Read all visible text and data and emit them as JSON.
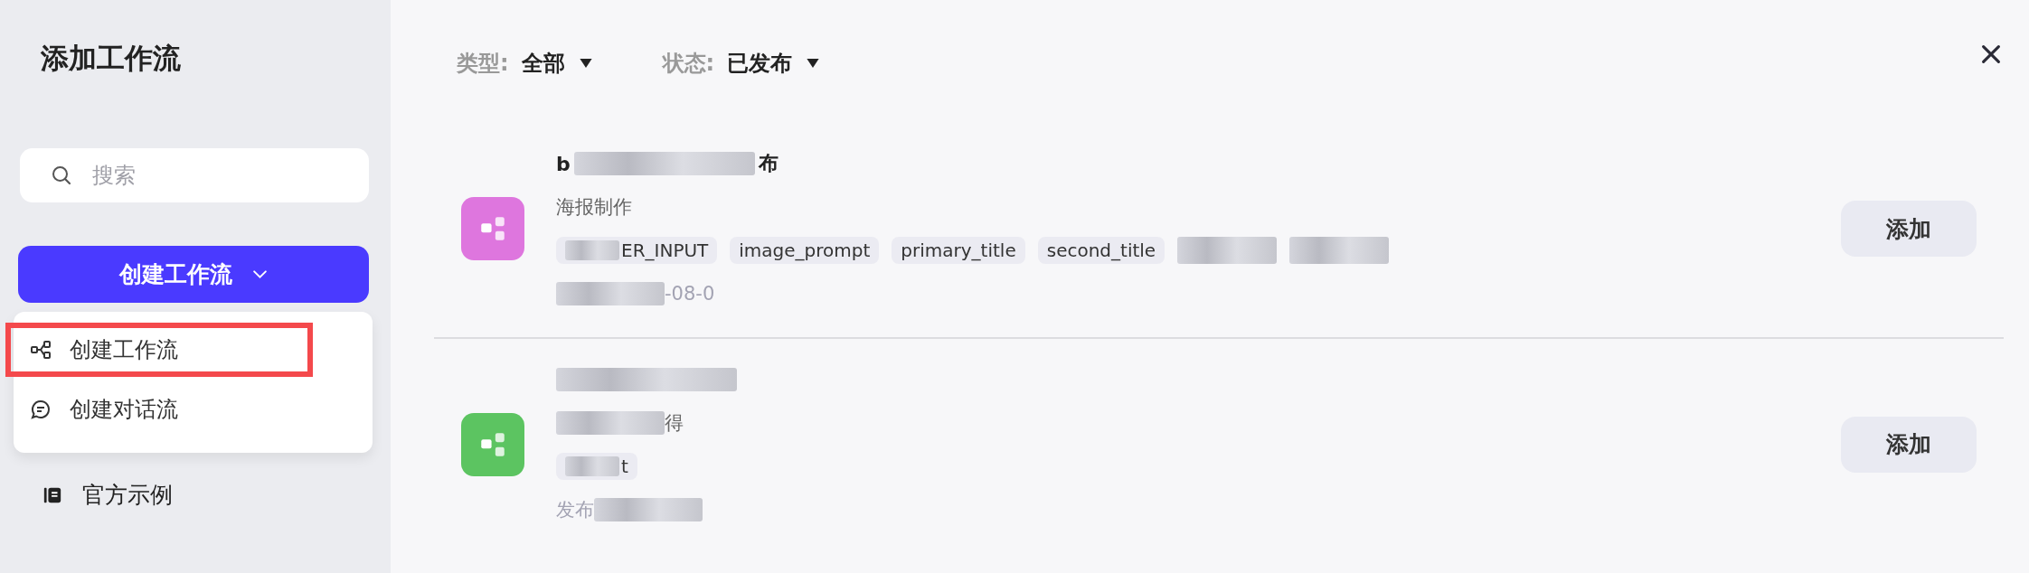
{
  "sidebar": {
    "title": "添加工作流",
    "search": {
      "placeholder": "搜索"
    },
    "create_button": {
      "label": "创建工作流"
    },
    "menu": [
      {
        "label": "创建工作流",
        "kind": "flow",
        "selected": true
      },
      {
        "label": "创建对话流",
        "kind": "chat",
        "selected": false
      }
    ],
    "links": [
      {
        "label": "官方示例"
      }
    ]
  },
  "filters": [
    {
      "label": "类型:",
      "value": "全部"
    },
    {
      "label": "状态:",
      "value": "已发布"
    }
  ],
  "items": [
    {
      "color": "#de76de",
      "title": [
        {
          "kind": "text",
          "text": "b"
        },
        {
          "kind": "mosaic"
        },
        {
          "kind": "text",
          "text": "布"
        }
      ],
      "description": [
        {
          "kind": "text",
          "text": "海报制作"
        }
      ],
      "tags": [
        [
          {
            "kind": "mosaic"
          },
          {
            "kind": "text",
            "text": "ER_INPUT"
          }
        ],
        [
          {
            "kind": "text",
            "text": "image_prompt"
          }
        ],
        [
          {
            "kind": "text",
            "text": "primary_title"
          }
        ],
        [
          {
            "kind": "text",
            "text": "second_title"
          }
        ],
        [
          {
            "kind": "mosaic"
          }
        ],
        [
          {
            "kind": "mosaic"
          }
        ]
      ],
      "meta": [
        {
          "kind": "mosaic"
        },
        {
          "kind": "text",
          "text": "-08-0"
        }
      ],
      "button": "添加"
    },
    {
      "color": "#5cc461",
      "title": [
        {
          "kind": "mosaic"
        }
      ],
      "description": [
        {
          "kind": "mosaic"
        },
        {
          "kind": "text",
          "text": "得"
        }
      ],
      "tags": [
        [
          {
            "kind": "mosaic"
          },
          {
            "kind": "text",
            "text": "t"
          }
        ]
      ],
      "meta": [
        {
          "kind": "text",
          "text": "发布"
        },
        {
          "kind": "mosaic"
        }
      ],
      "button": "添加"
    }
  ]
}
